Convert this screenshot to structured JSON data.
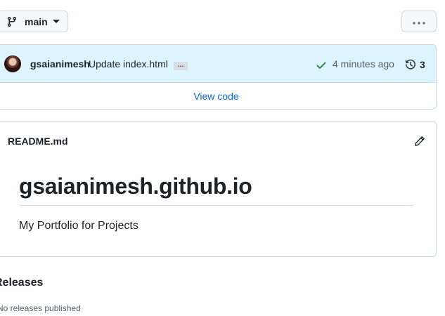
{
  "branch": {
    "name": "main",
    "icon": "git-branch-icon",
    "caret_icon": "triangle-down-icon"
  },
  "more_button": {
    "icon": "kebab-horizontal-icon"
  },
  "commit": {
    "author": "gsaianimesh",
    "message": "Update index.html",
    "ellipsis": "…",
    "status_icon": "check-icon",
    "status_color": "#1a7f37",
    "time": "4 minutes ago",
    "history_icon": "history-icon",
    "history_count": "3",
    "view_code_label": "View code",
    "row_background": "#ddf4ff",
    "link_color": "#0969da"
  },
  "readme": {
    "filename": "README.md",
    "edit_icon": "pencil-icon",
    "title": "gsaianimesh.github.io",
    "description": "My Portfolio for Projects"
  },
  "releases": {
    "heading": "Releases",
    "empty_text": "No releases published"
  }
}
